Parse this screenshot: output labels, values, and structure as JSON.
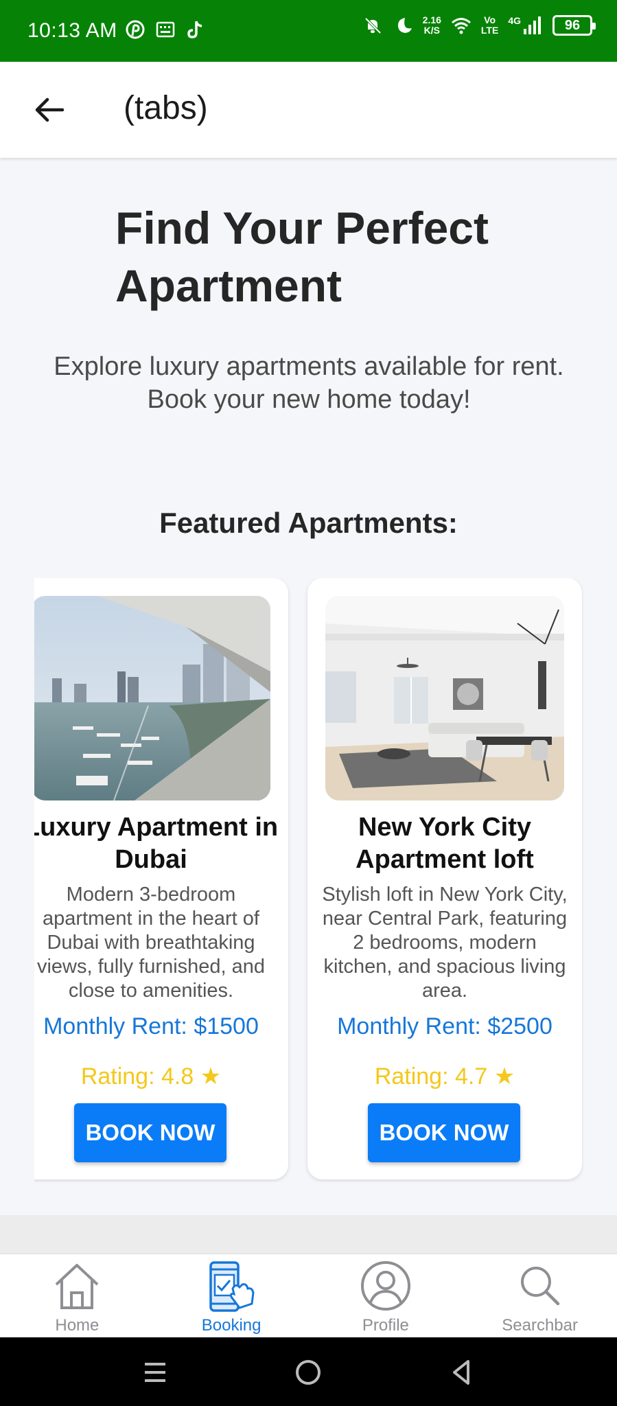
{
  "status_bar": {
    "time": "10:13 AM",
    "net_speed_value": "2.16",
    "net_speed_unit": "K/S",
    "volte_top": "Vo",
    "volte_bottom": "LTE",
    "network": "4G",
    "battery": "96",
    "background_color": "#068306"
  },
  "header": {
    "title": "(tabs)",
    "back_icon": "arrow-left-icon"
  },
  "hero": {
    "title": "Find Your Perfect Apartment",
    "subtitle": "Explore luxury apartments available for rent. Book your new home today!"
  },
  "featured": {
    "heading": "Featured Apartments:",
    "cards": [
      {
        "title": "Luxury Apartment in Dubai",
        "description": "Modern 3-bedroom apartment in the heart of Dubai with breathtaking views, fully furnished, and close to amenities.",
        "rent": "Monthly Rent: $1500",
        "rating": "Rating: 4.8 ★",
        "button": "BOOK NOW"
      },
      {
        "title": "New York City Apartment loft",
        "description": "Stylish loft in New York City, near Central Park, featuring 2 bedrooms, modern kitchen, and spacious living area.",
        "rent": "Monthly Rent: $2500",
        "rating": "Rating: 4.7 ★",
        "button": "BOOK NOW"
      }
    ]
  },
  "tabs": [
    {
      "label": "Home",
      "icon": "home-icon",
      "active": false
    },
    {
      "label": "Booking",
      "icon": "booking-icon",
      "active": true
    },
    {
      "label": "Profile",
      "icon": "profile-icon",
      "active": false
    },
    {
      "label": "Searchbar",
      "icon": "search-icon",
      "active": false
    }
  ],
  "colors": {
    "accent": "#1677d9",
    "button": "#0a7cf7",
    "rating": "#f4c81a",
    "tab_inactive": "#8e8e93"
  }
}
